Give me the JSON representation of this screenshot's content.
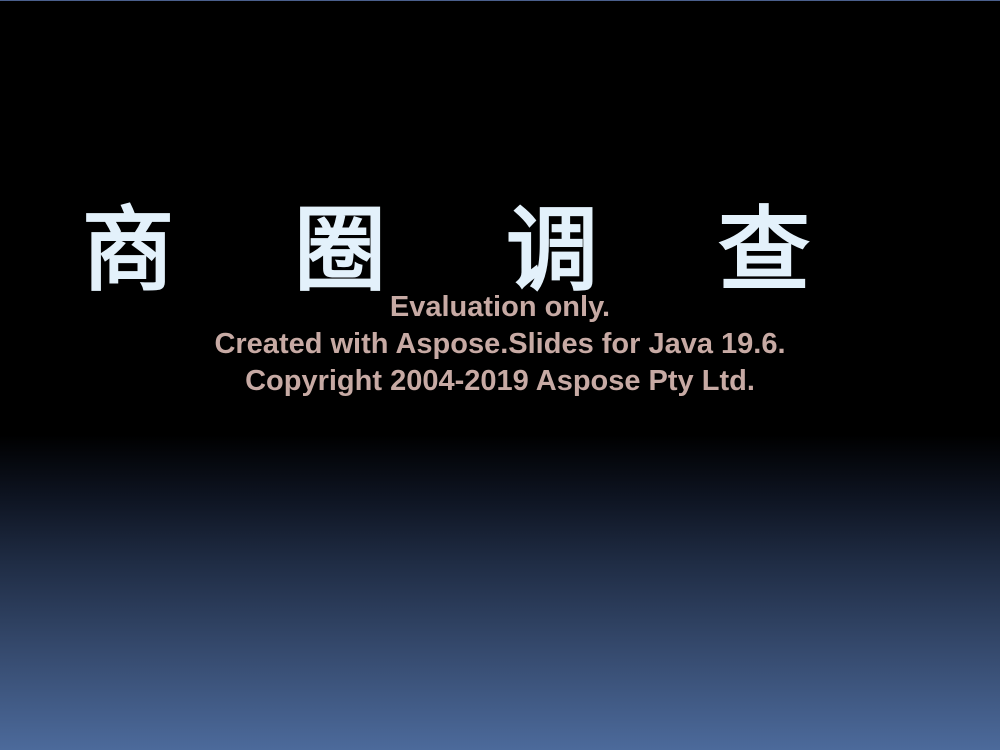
{
  "slide": {
    "title": "商 圈 调 查"
  },
  "watermark": {
    "line1": "Evaluation only.",
    "line2": "Created with Aspose.Slides for Java 19.6.",
    "line3": "Copyright 2004-2019 Aspose Pty Ltd."
  },
  "colors": {
    "title": "#e3f1fb",
    "watermark": "#c7aaa4",
    "background_top": "#000000",
    "background_bottom": "#4c6a9b"
  }
}
